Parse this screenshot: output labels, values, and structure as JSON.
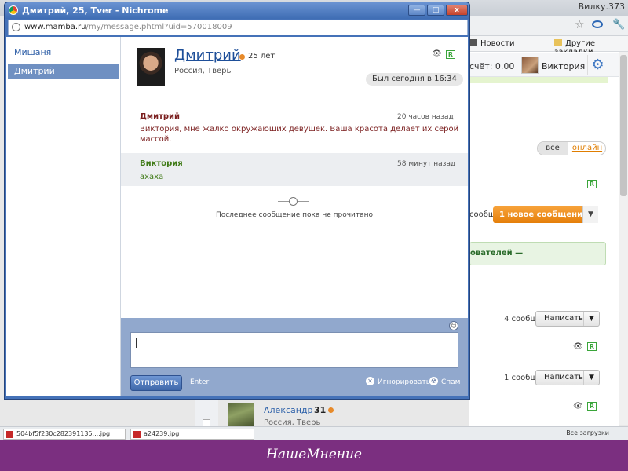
{
  "background": {
    "counter": "Вилку.373",
    "bookmarks": [
      "Новости",
      "Другие закладки"
    ],
    "balance": "счёт: 0.00",
    "user_name": "Виктория",
    "toggle": {
      "all": "все",
      "online": "онлайн"
    },
    "msgs_frag": "сообщ.",
    "new_message_btn": "1 новое сообщение",
    "users_frag": "ователей —",
    "rows": [
      {
        "count": "4 сообщ.",
        "button": "Написать"
      },
      {
        "count": "1 сообщ.",
        "button": "Написать"
      }
    ],
    "profile": {
      "name": "Александр",
      "age": "31",
      "location": "Россия, Тверь"
    },
    "downloads": [
      "504bf5f230c282391135....jpg",
      "a24239.jpg"
    ],
    "downloads_all": "Все загрузки"
  },
  "popup": {
    "title": "Дмитрий, 25, Tver - Nichrome",
    "url_host": "www.mamba.ru",
    "url_rest": "/my/message.phtml?uid=570018009",
    "window_buttons": [
      "—",
      "□",
      "x"
    ],
    "contacts": [
      {
        "name": "Мишаня",
        "selected": false
      },
      {
        "name": "Дмитрий",
        "selected": true
      }
    ],
    "profile": {
      "name": "Дмитрий",
      "age": "25 лет",
      "location": "Россия, Тверь",
      "last_seen": "Был сегодня в 16:34",
      "badge": "R"
    },
    "messages": [
      {
        "author": "Дмитрий",
        "time": "20 часов назад",
        "text_line1": "Виктория, мне жалко окружающих девушек. Ваша красота делает их серой",
        "text_line2": "массой."
      },
      {
        "author": "Виктория",
        "time": "58 минут назад",
        "text": "ахаха"
      }
    ],
    "unread_notice": "Последнее сообщение пока не прочитано",
    "compose": {
      "input_value": "",
      "send_label": "Отправить",
      "enter_label": "Enter",
      "ignore_label": "Игнорировать",
      "spam_label": "Спам"
    }
  },
  "footer": {
    "logo": "НашеМнение"
  },
  "colors": {
    "window_blue": "#4572b8",
    "selected_contact": "#6f90c2",
    "author_dmitry": "#7a1e1e",
    "author_viktoria": "#3f7a16",
    "orange_button": "#e57f0a",
    "footer_purple": "#7b2f80"
  }
}
